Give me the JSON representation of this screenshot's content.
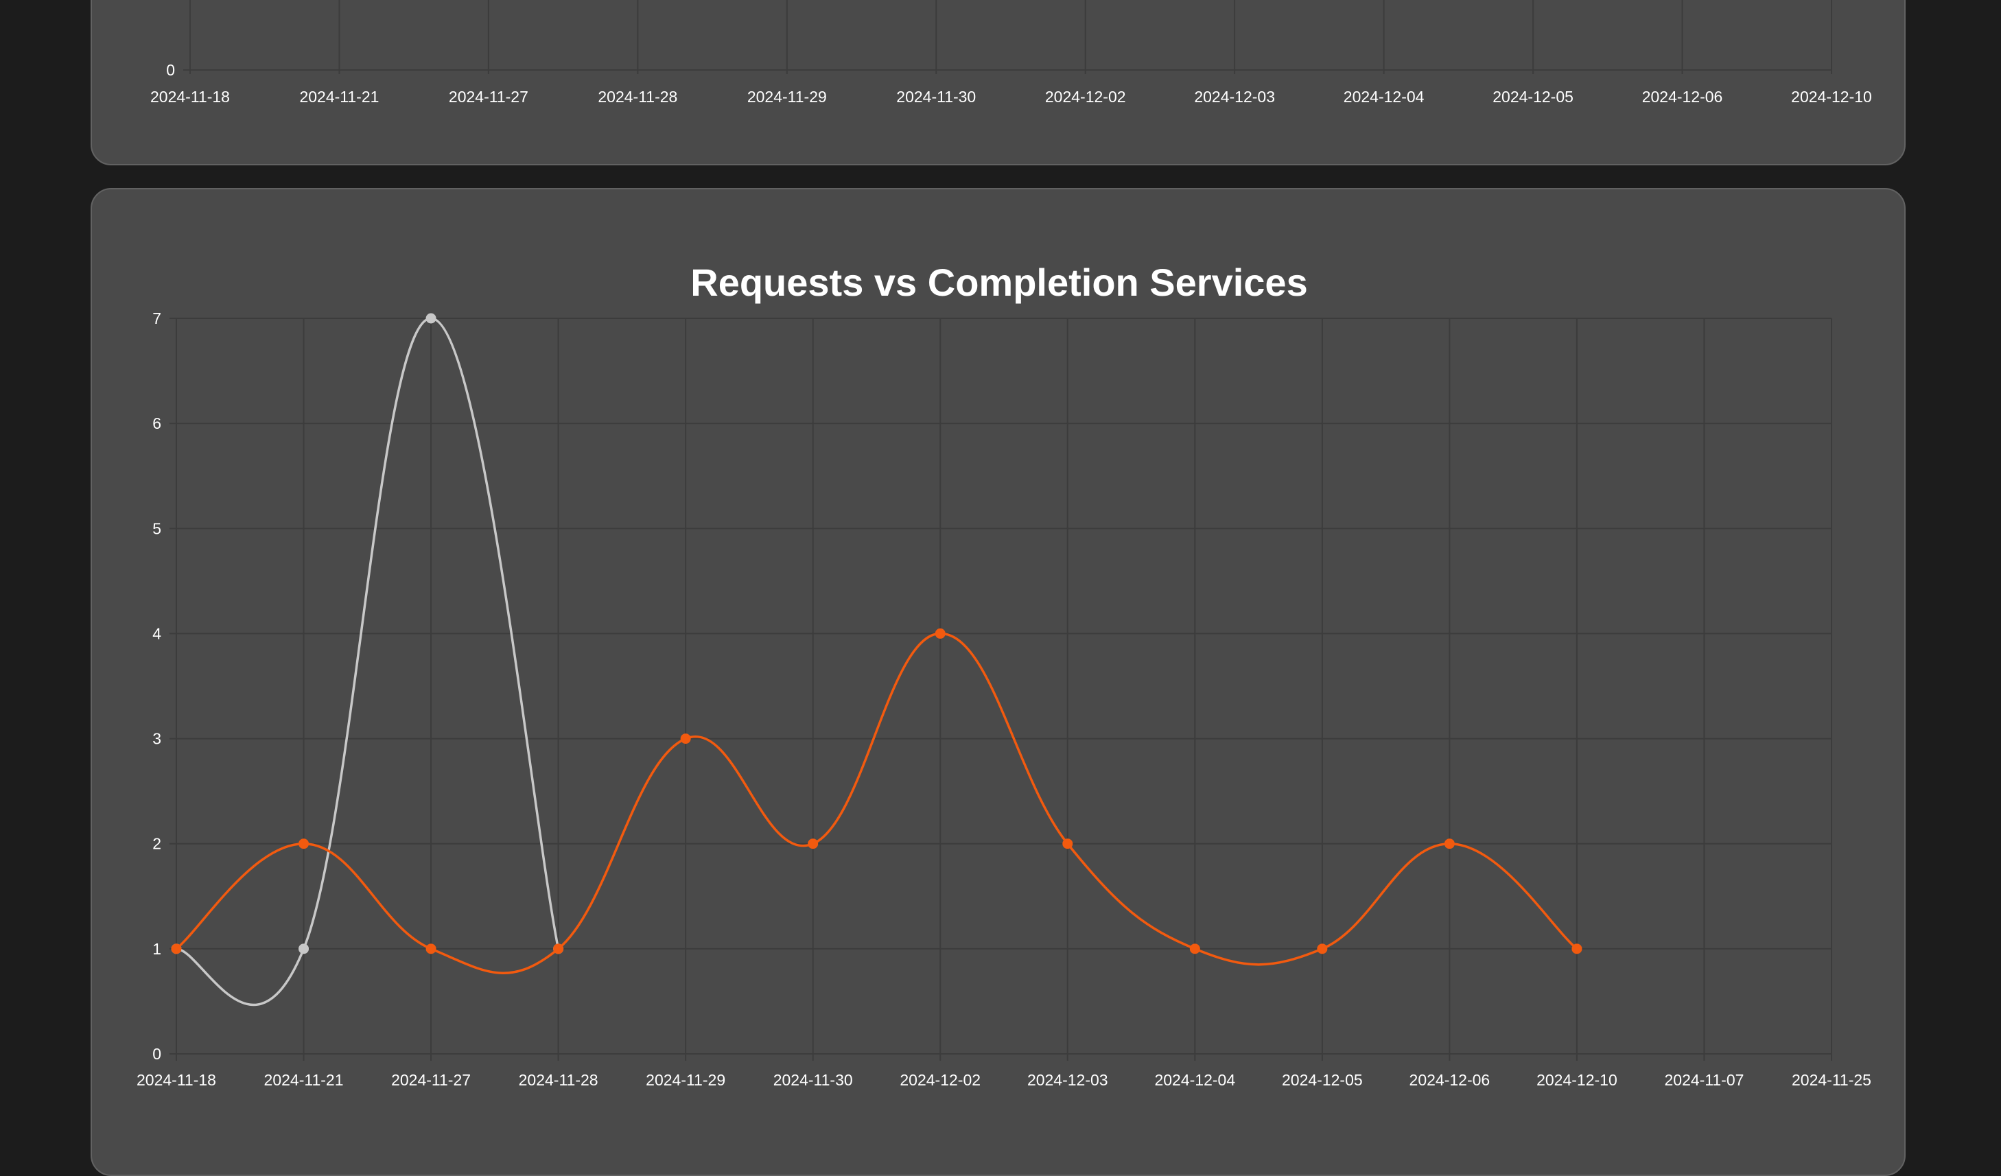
{
  "colors": {
    "background": "#1c1c1c",
    "card": "#4a4a4a",
    "grid": "#3c3c3c",
    "requests_line": "#c8c8c8",
    "completion_line": "#f25a0f",
    "text": "#ffffff"
  },
  "chart_data": [
    {
      "type": "line",
      "title": "",
      "categories": [
        "2024-11-18",
        "2024-11-21",
        "2024-11-27",
        "2024-11-28",
        "2024-11-29",
        "2024-11-30",
        "2024-12-02",
        "2024-12-03",
        "2024-12-04",
        "2024-12-05",
        "2024-12-06",
        "2024-12-10"
      ],
      "y_ticks": [
        "0"
      ],
      "series": [],
      "partially_visible": true
    },
    {
      "type": "line",
      "title": "Requests vs Completion Services",
      "xlabel": "",
      "ylabel": "",
      "ylim": [
        0,
        7
      ],
      "y_ticks": [
        "0",
        "1",
        "2",
        "3",
        "4",
        "5",
        "6",
        "7"
      ],
      "categories": [
        "2024-11-18",
        "2024-11-21",
        "2024-11-27",
        "2024-11-28",
        "2024-11-29",
        "2024-11-30",
        "2024-12-02",
        "2024-12-03",
        "2024-12-04",
        "2024-12-05",
        "2024-12-06",
        "2024-12-10",
        "2024-11-07",
        "2024-11-25"
      ],
      "grid": true,
      "legend": "none",
      "series": [
        {
          "color": "#c8c8c8",
          "values": [
            1,
            1,
            7,
            1
          ]
        },
        {
          "color": "#f25a0f",
          "values": [
            1,
            2,
            1,
            1,
            3,
            2,
            4,
            2,
            1,
            1,
            2,
            1
          ]
        }
      ]
    }
  ]
}
